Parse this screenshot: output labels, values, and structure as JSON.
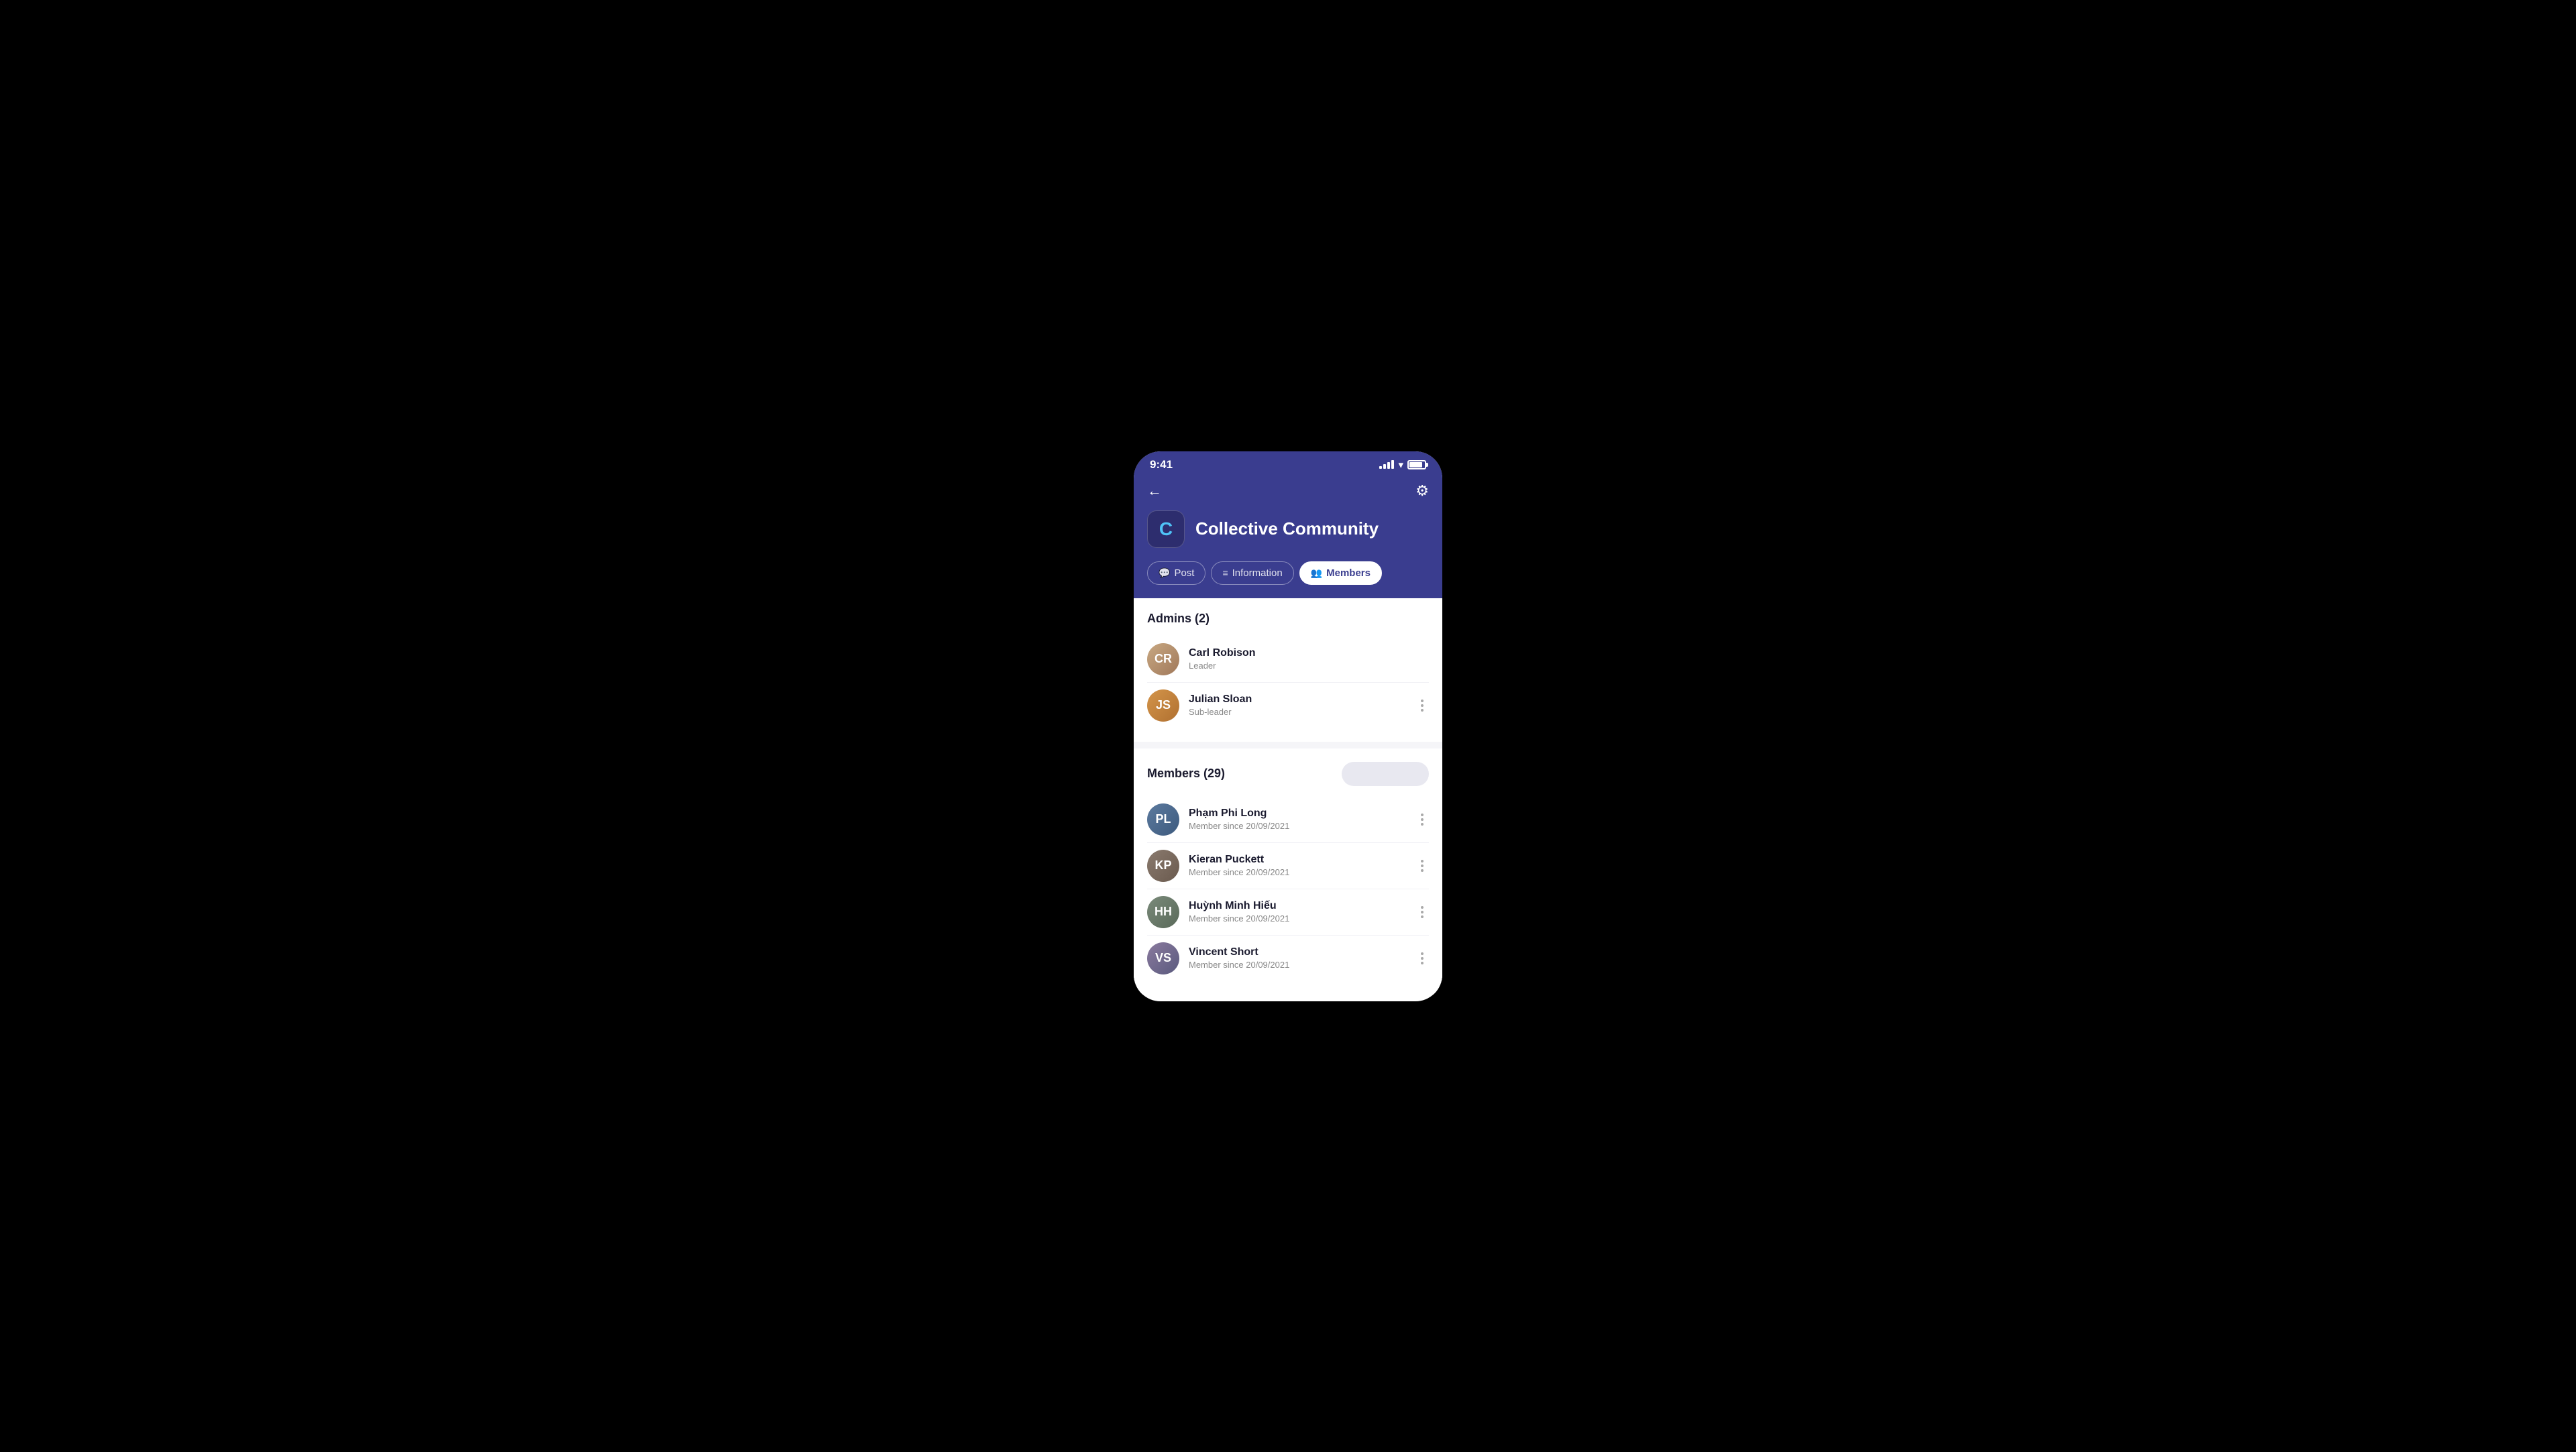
{
  "statusBar": {
    "time": "9:41"
  },
  "header": {
    "communityName": "Collective Community",
    "communityLogoChar": "C"
  },
  "tabs": [
    {
      "id": "post",
      "label": "Post",
      "icon": "💬",
      "active": false
    },
    {
      "id": "information",
      "label": "Information",
      "icon": "≡",
      "active": false
    },
    {
      "id": "members",
      "label": "Members",
      "icon": "👥",
      "active": true
    }
  ],
  "admins": {
    "sectionTitle": "Admins (2)",
    "list": [
      {
        "name": "Carl Robison",
        "role": "Leader",
        "hasMenu": false,
        "initials": "CR",
        "color": "#c8a882"
      },
      {
        "name": "Julian Sloan",
        "role": "Sub-leader",
        "hasMenu": true,
        "initials": "JS",
        "color": "#d4954a"
      }
    ]
  },
  "members": {
    "sectionTitle": "Members (29)",
    "searchPlaceholder": "",
    "list": [
      {
        "name": "Phạm Phi Long",
        "role": "Member since 20/09/2021",
        "hasMenu": true,
        "initials": "PL",
        "color": "#5c7a9e"
      },
      {
        "name": "Kieran Puckett",
        "role": "Member since 20/09/2021",
        "hasMenu": true,
        "initials": "KP",
        "color": "#8a7a6e"
      },
      {
        "name": "Huỳnh Minh Hiếu",
        "role": "Member since 20/09/2021",
        "hasMenu": true,
        "initials": "HH",
        "color": "#7a8a7a"
      },
      {
        "name": "Vincent Short",
        "role": "Member since 20/09/2021",
        "hasMenu": true,
        "initials": "VS",
        "color": "#8a7a9e"
      }
    ]
  }
}
